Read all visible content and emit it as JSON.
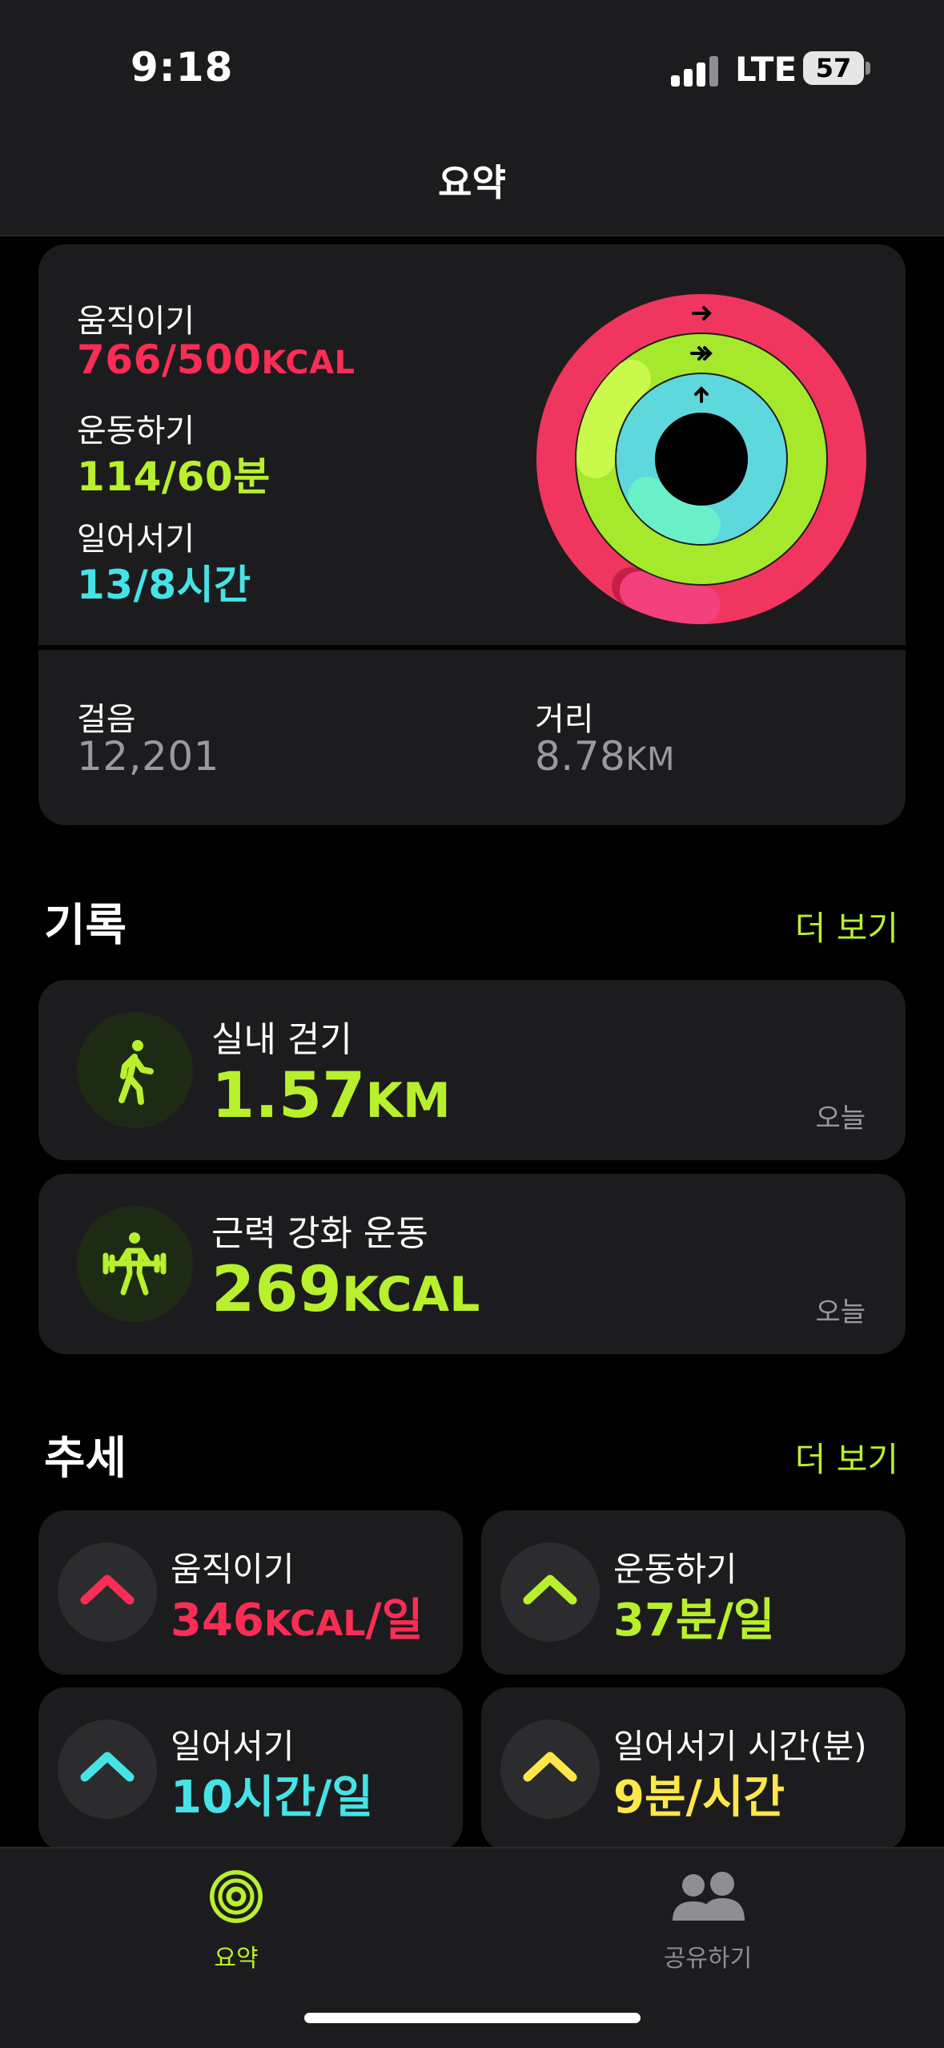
{
  "status_bar": {
    "time": "9:18",
    "network": "LTE",
    "battery": "57"
  },
  "nav": {
    "title": "요약"
  },
  "summary": {
    "move": {
      "label": "움직이기",
      "value": "766/500",
      "unit": "KCAL",
      "color": "#fa2d55"
    },
    "exercise": {
      "label": "운동하기",
      "value": "114/60분",
      "color": "#b8f02d"
    },
    "stand": {
      "label": "일어서기",
      "value": "13/8시간",
      "color": "#46e3e6"
    },
    "rings": {
      "move_progress": 1.532,
      "exercise_progress": 1.9,
      "stand_progress": 1.625
    },
    "steps": {
      "label": "걸음",
      "value": "12,201"
    },
    "distance": {
      "label": "거리",
      "value": "8.78",
      "unit": "KM"
    }
  },
  "history": {
    "title": "기록",
    "see_more": "더 보기",
    "items": [
      {
        "name": "실내 걷기",
        "value": "1.57",
        "unit": "KM",
        "date": "오늘",
        "icon": "walking-figure-icon"
      },
      {
        "name": "근력 강화 운동",
        "value": "269",
        "unit": "KCAL",
        "date": "오늘",
        "icon": "weightlifting-figure-icon"
      }
    ]
  },
  "trends": {
    "title": "추세",
    "see_more": "더 보기",
    "items": [
      {
        "label": "움직이기",
        "value": "346",
        "unit": "KCAL",
        "suffix": "/일",
        "color": "#fa2d55"
      },
      {
        "label": "운동하기",
        "value": "37분/일",
        "color": "#b8f02d"
      },
      {
        "label": "일어서기",
        "value": "10시간/일",
        "color": "#46e3e6"
      },
      {
        "label": "일어서기 시간(분)",
        "value": "9분/시간",
        "color": "#ffe74a"
      }
    ]
  },
  "tab_bar": {
    "tabs": [
      {
        "label": "요약",
        "icon": "activity-rings-icon",
        "active": true
      },
      {
        "label": "공유하기",
        "icon": "people-icon",
        "active": false
      }
    ]
  }
}
